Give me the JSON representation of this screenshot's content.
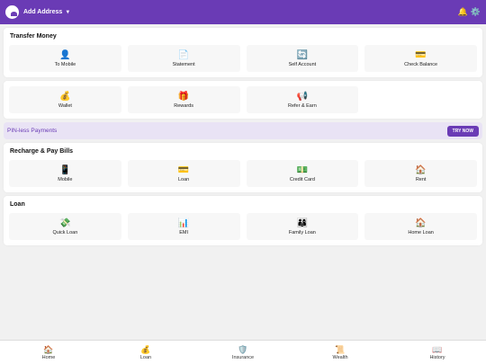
{
  "header": {
    "address_label": "Add Address",
    "caret": "▼",
    "icons": [
      "bell-icon",
      "gear-icon"
    ],
    "bell": "🔔",
    "gear": "⚙️"
  },
  "transfer": {
    "title": "Transfer Money",
    "items": [
      {
        "label": "To Mobile",
        "icon": "👤"
      },
      {
        "label": "Statement",
        "icon": "📄"
      },
      {
        "label": "Self Account",
        "icon": "🔄"
      },
      {
        "label": "Check Balance",
        "icon": "💳"
      }
    ]
  },
  "extras": {
    "items": [
      {
        "label": "Wallet",
        "icon": "💰"
      },
      {
        "label": "Rewards",
        "icon": "🎁"
      },
      {
        "label": "Refer & Earn",
        "icon": "📢"
      }
    ]
  },
  "promo": {
    "text": "PIN-less Payments",
    "button": "TRY NOW"
  },
  "recharge": {
    "title": "Recharge & Pay Bills",
    "items": [
      {
        "label": "Mobile",
        "icon": "📱"
      },
      {
        "label": "Loan",
        "icon": "💳"
      },
      {
        "label": "Credit Card",
        "icon": "💵"
      },
      {
        "label": "Rent",
        "icon": "🏠"
      }
    ]
  },
  "loan": {
    "title": "Loan",
    "items": [
      {
        "label": "Quick Loan",
        "icon": "💸"
      },
      {
        "label": "EMI",
        "icon": "📊"
      },
      {
        "label": "Family Loan",
        "icon": "👨‍👩‍👦"
      },
      {
        "label": "Home Loan",
        "icon": "🏠"
      }
    ]
  },
  "nav": [
    {
      "label": "Home",
      "icon": "🏠"
    },
    {
      "label": "Loan",
      "icon": "💰"
    },
    {
      "label": "Insurance",
      "icon": "🛡️"
    },
    {
      "label": "Wealth",
      "icon": "📜"
    },
    {
      "label": "History",
      "icon": "📖"
    }
  ],
  "colors": {
    "brand": "#6a3bb5",
    "promo_bg": "#e9e3f5"
  }
}
